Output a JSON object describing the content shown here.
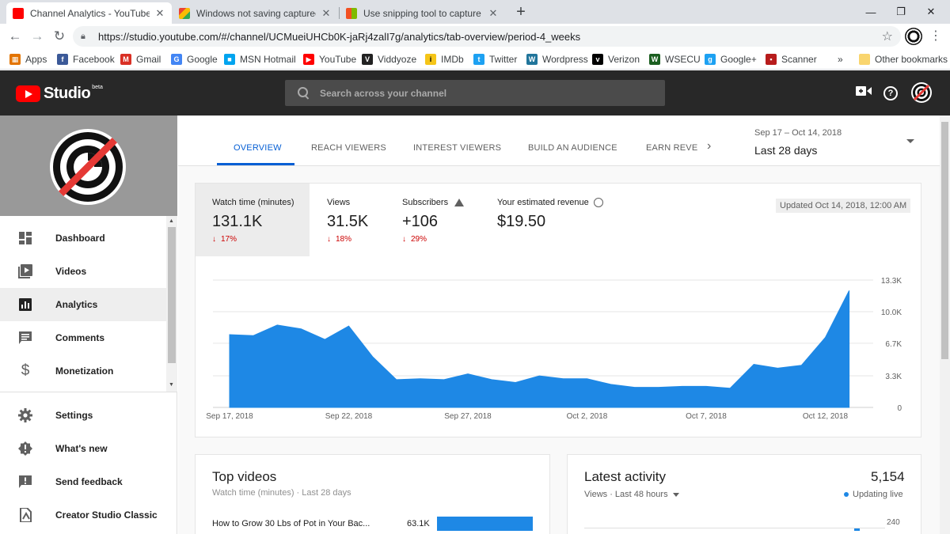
{
  "browser": {
    "tabs": [
      {
        "title": "Channel Analytics - YouTube Studio",
        "color": "#ff0000"
      },
      {
        "title": "Windows not saving captured Screen",
        "color": "#4285f4"
      },
      {
        "title": "Use snipping tool to capture screenshots",
        "color": "#f25022"
      }
    ],
    "tab_close": "✕",
    "new_tab": "+",
    "window_controls": [
      "—",
      "❐",
      "✕"
    ],
    "url": "https://studio.youtube.com/#/channel/UCMueiUHCb0K-jaRj4zalI7g/analytics/tab-overview/period-4_weeks",
    "bookmarks": [
      {
        "label": "Apps",
        "icon": "apps-icon",
        "color": "#e37400"
      },
      {
        "label": "Facebook",
        "icon": "facebook-icon",
        "color": "#3b5998"
      },
      {
        "label": "Gmail",
        "icon": "gmail-icon",
        "color": "#d93025"
      },
      {
        "label": "Google",
        "icon": "google-icon",
        "color": "#4285f4"
      },
      {
        "label": "MSN Hotmail",
        "icon": "msn-icon",
        "color": "#00a4ef"
      },
      {
        "label": "YouTube",
        "icon": "youtube-icon",
        "color": "#ff0000"
      },
      {
        "label": "Viddyoze",
        "icon": "viddyoze-icon",
        "color": "#222222"
      },
      {
        "label": "IMDb",
        "icon": "imdb-icon",
        "color": "#f5c518"
      },
      {
        "label": "Twitter",
        "icon": "twitter-icon",
        "color": "#1da1f2"
      },
      {
        "label": "Wordpress",
        "icon": "wordpress-icon",
        "color": "#21759b"
      },
      {
        "label": "Verizon",
        "icon": "verizon-icon",
        "color": "#000000"
      },
      {
        "label": "WSECU",
        "icon": "wsecu-icon",
        "color": "#1b5e20"
      },
      {
        "label": "Google+",
        "icon": "googleplus-icon",
        "color": "#1da1f2"
      },
      {
        "label": "Scanner",
        "icon": "scanner-icon",
        "color": "#b71c1c"
      }
    ],
    "bookmarks_more": "»",
    "other_bookmarks": "Other bookmarks"
  },
  "studio": {
    "logo_text": "Studio",
    "beta": "beta",
    "search_placeholder": "Search across your channel"
  },
  "sidebar": {
    "items": [
      {
        "label": "Dashboard",
        "icon": "dashboard-icon"
      },
      {
        "label": "Videos",
        "icon": "videos-icon"
      },
      {
        "label": "Analytics",
        "icon": "analytics-icon",
        "active": true
      },
      {
        "label": "Comments",
        "icon": "comments-icon"
      },
      {
        "label": "Monetization",
        "icon": "monetization-icon"
      }
    ],
    "bottom_items": [
      {
        "label": "Settings",
        "icon": "settings-icon"
      },
      {
        "label": "What's new",
        "icon": "whats-new-icon"
      },
      {
        "label": "Send feedback",
        "icon": "feedback-icon"
      },
      {
        "label": "Creator Studio Classic",
        "icon": "classic-icon"
      }
    ]
  },
  "analytics": {
    "tabs": [
      "OVERVIEW",
      "REACH VIEWERS",
      "INTEREST VIEWERS",
      "BUILD AN AUDIENCE",
      "EARN REVE"
    ],
    "active_tab": "OVERVIEW",
    "date_range": "Sep 17 – Oct 14, 2018",
    "date_label": "Last 28 days",
    "updated": "Updated Oct 14, 2018, 12:00 AM",
    "metrics": [
      {
        "label": "Watch time (minutes)",
        "value": "131.1K",
        "delta": "17%",
        "direction": "down"
      },
      {
        "label": "Views",
        "value": "31.5K",
        "delta": "18%",
        "direction": "down"
      },
      {
        "label": "Subscribers",
        "value": "+106",
        "delta": "29%",
        "direction": "down"
      },
      {
        "label": "Your estimated revenue",
        "value": "$19.50"
      }
    ],
    "delta_arrow": "↓"
  },
  "chart_data": {
    "type": "area",
    "series": [
      {
        "values": [
          7.6,
          7.5,
          8.6,
          8.2,
          7.1,
          8.5,
          5.3,
          2.9,
          3.0,
          2.9,
          3.5,
          2.9,
          2.6,
          3.3,
          3.0,
          3.0,
          2.4,
          2.1,
          2.1,
          2.2,
          2.2,
          2.0,
          4.5,
          4.1,
          4.4,
          7.3,
          12.2
        ]
      }
    ],
    "x": [
      "Sep 17",
      "Sep 18",
      "Sep 19",
      "Sep 20",
      "Sep 21",
      "Sep 22",
      "Sep 23",
      "Sep 24",
      "Sep 25",
      "Sep 26",
      "Sep 27",
      "Sep 28",
      "Sep 29",
      "Sep 30",
      "Oct 1",
      "Oct 2",
      "Oct 3",
      "Oct 4",
      "Oct 5",
      "Oct 6",
      "Oct 7",
      "Oct 8",
      "Oct 9",
      "Oct 10",
      "Oct 11",
      "Oct 12",
      "Oct 13"
    ],
    "x_tick_labels": [
      "Sep 17, 2018",
      "Sep 22, 2018",
      "Sep 27, 2018",
      "Oct 2, 2018",
      "Oct 7, 2018",
      "Oct 12, 2018"
    ],
    "y_tick_labels": [
      "0",
      "3.3K",
      "6.7K",
      "10.0K",
      "13.3K"
    ],
    "y_ticks": [
      0,
      3.3,
      6.7,
      10.0,
      13.3
    ],
    "ylim": [
      0,
      13.3
    ],
    "color": "#1e88e5",
    "grid": true
  },
  "top_videos": {
    "title": "Top videos",
    "subtitle": "Watch time (minutes) · Last 28 days",
    "rows": [
      {
        "title": "How to Grow 30 Lbs of Pot in Your Bac...",
        "value": "63.1K",
        "fraction": 1.0
      }
    ]
  },
  "latest_activity": {
    "title": "Latest activity",
    "subtitle": "Views · Last 48 hours",
    "count": "5,154",
    "live": "Updating live",
    "axis_top": "240"
  }
}
